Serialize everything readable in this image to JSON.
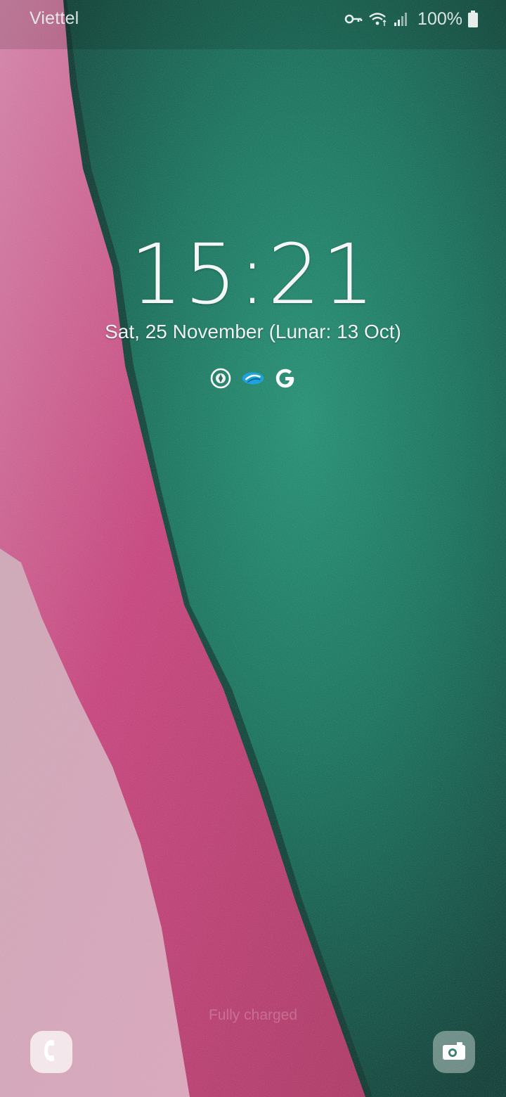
{
  "status_bar": {
    "carrier": "Viettel",
    "battery_percent": "100%",
    "icons": [
      "vpn-key-icon",
      "wifi-icon",
      "signal-icon",
      "battery-icon"
    ]
  },
  "lockscreen": {
    "time": "15:21",
    "date": "Sat, 25 November (Lunar: 13 Oct)",
    "notification_icons": [
      "compass-icon",
      "messaging-app-icon",
      "google-icon"
    ],
    "charging_status": "Fully charged"
  },
  "shortcuts": {
    "left": "phone-icon",
    "right": "camera-icon"
  },
  "colors": {
    "wallpaper_green": "#0e6a55",
    "wallpaper_pink": "#c4407a",
    "accent_blue": "#1fa3e0"
  }
}
